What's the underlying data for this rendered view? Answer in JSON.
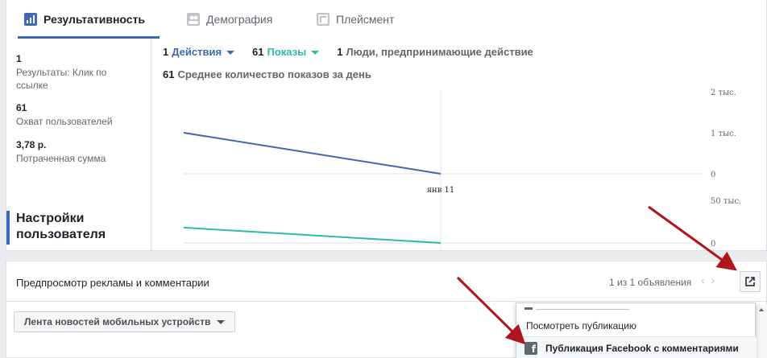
{
  "tabs": [
    {
      "label": "Результативность",
      "icon": "bar-chart-icon",
      "active": true
    },
    {
      "label": "Демография",
      "icon": "people-icon",
      "active": false
    },
    {
      "label": "Плейсмент",
      "icon": "placement-icon",
      "active": false
    }
  ],
  "sidebar": {
    "metrics": [
      {
        "value": "1",
        "label": "Результаты: Клик по ссылке"
      },
      {
        "value": "61",
        "label": "Охват пользователей"
      },
      {
        "value": "3,78 р.",
        "label": "Потраченная сумма"
      }
    ],
    "settings_label": "Настройки пользователя"
  },
  "legend": {
    "actions_num": "1",
    "actions_label": "Действия",
    "impressions_num": "61",
    "impressions_label": "Показы",
    "people_num": "1",
    "people_label": "Люди, предпринимающие действие",
    "avg_num": "61",
    "avg_label": "Среднее количество показов за день"
  },
  "chart_data": [
    {
      "type": "line",
      "x": [
        "",
        "янв 11"
      ],
      "series": [
        {
          "values": [
            1000,
            0
          ],
          "color": "#4267b2"
        }
      ],
      "yticks": [
        "2 тыс.",
        "1 тыс.",
        "0"
      ],
      "ylim": [
        0,
        2000
      ]
    },
    {
      "type": "line",
      "x": [
        "",
        "янв 11"
      ],
      "series": [
        {
          "values": [
            18000,
            0
          ],
          "color": "#2abba7"
        }
      ],
      "yticks": [
        "50 тыс.",
        "0"
      ],
      "ylim": [
        0,
        50000
      ]
    }
  ],
  "preview": {
    "title": "Предпросмотр рекламы и комментарии",
    "count": "1 из 1 объявления",
    "prev": "‹",
    "next": "›",
    "placement_dropdown": "Лента новостей мобильных устройств"
  },
  "popup": {
    "header": "Посмотреть публикацию",
    "item": "Публикация Facebook с комментариями"
  },
  "colors": {
    "accent": "#4267b2",
    "teal": "#2abba7",
    "arrow": "#b0141c"
  }
}
